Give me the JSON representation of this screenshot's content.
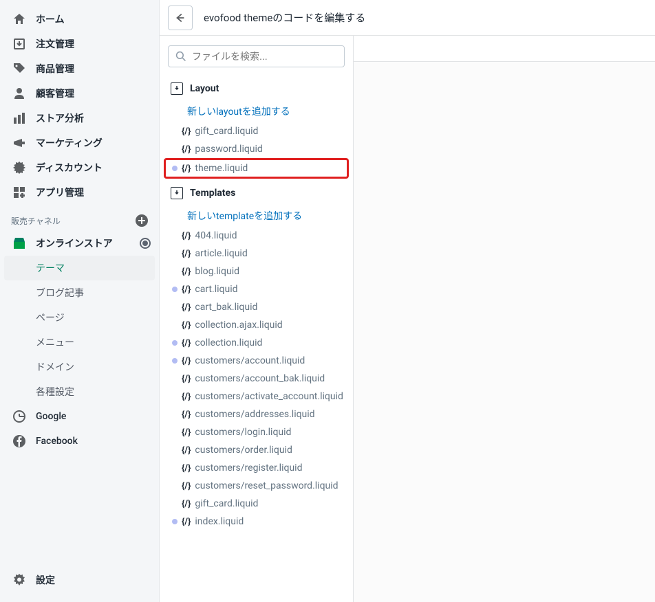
{
  "sidebar": {
    "nav": [
      {
        "label": "ホーム"
      },
      {
        "label": "注文管理"
      },
      {
        "label": "商品管理"
      },
      {
        "label": "顧客管理"
      },
      {
        "label": "ストア分析"
      },
      {
        "label": "マーケティング"
      },
      {
        "label": "ディスカウント"
      },
      {
        "label": "アプリ管理"
      }
    ],
    "channels_header": "販売チャネル",
    "online_store": "オンラインストア",
    "online_store_sub": [
      {
        "label": "テーマ",
        "active": true
      },
      {
        "label": "ブログ記事"
      },
      {
        "label": "ページ"
      },
      {
        "label": "メニュー"
      },
      {
        "label": "ドメイン"
      },
      {
        "label": "各種設定"
      }
    ],
    "google": "Google",
    "facebook": "Facebook",
    "settings": "設定"
  },
  "header": {
    "title": "evofood themeのコードを編集する"
  },
  "file_panel": {
    "search_placeholder": "ファイルを検索...",
    "sections": [
      {
        "title": "Layout",
        "add_label": "新しいlayoutを追加する",
        "files": [
          {
            "name": "gift_card.liquid",
            "dot": false
          },
          {
            "name": "password.liquid",
            "dot": false
          },
          {
            "name": "theme.liquid",
            "dot": true,
            "highlight": true
          }
        ]
      },
      {
        "title": "Templates",
        "add_label": "新しいtemplateを追加する",
        "files": [
          {
            "name": "404.liquid",
            "dot": false
          },
          {
            "name": "article.liquid",
            "dot": false
          },
          {
            "name": "blog.liquid",
            "dot": false
          },
          {
            "name": "cart.liquid",
            "dot": true
          },
          {
            "name": "cart_bak.liquid",
            "dot": false
          },
          {
            "name": "collection.ajax.liquid",
            "dot": false
          },
          {
            "name": "collection.liquid",
            "dot": true
          },
          {
            "name": "customers/account.liquid",
            "dot": true
          },
          {
            "name": "customers/account_bak.liquid",
            "dot": false
          },
          {
            "name": "customers/activate_account.liquid",
            "dot": false
          },
          {
            "name": "customers/addresses.liquid",
            "dot": false
          },
          {
            "name": "customers/login.liquid",
            "dot": false
          },
          {
            "name": "customers/order.liquid",
            "dot": false
          },
          {
            "name": "customers/register.liquid",
            "dot": false
          },
          {
            "name": "customers/reset_password.liquid",
            "dot": false
          },
          {
            "name": "gift_card.liquid",
            "dot": false
          },
          {
            "name": "index.liquid",
            "dot": true
          }
        ]
      }
    ]
  }
}
